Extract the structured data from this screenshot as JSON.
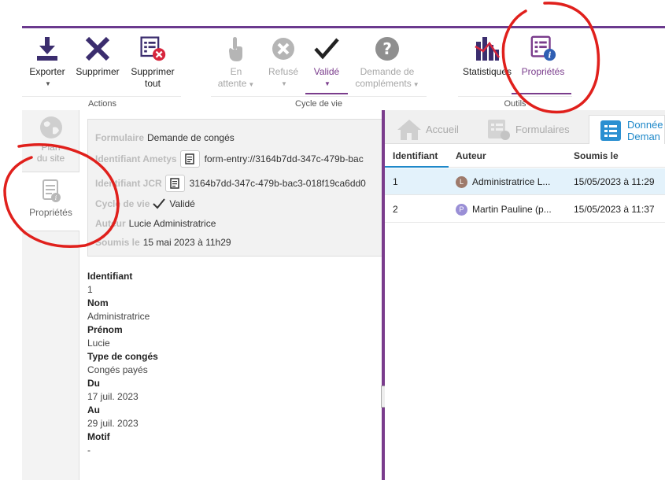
{
  "ribbon": {
    "buttons": {
      "exporter": "Exporter",
      "supprimer": "Supprimer",
      "supprimer_tout_l1": "Supprimer",
      "supprimer_tout_l2": "tout",
      "en_attente_l1": "En",
      "en_attente_l2": "attente",
      "refuse": "Refusé",
      "valide": "Validé",
      "demande_l1": "Demande de",
      "demande_l2": "compléments",
      "statistiques": "Statistiques",
      "proprietes": "Propriétés"
    },
    "groups": {
      "actions": "Actions",
      "cycle": "Cycle de vie",
      "outils": "Outils"
    }
  },
  "left_tabs": {
    "plan_l1": "Plan",
    "plan_l2": "du site",
    "proprietes": "Propriétés"
  },
  "properties": {
    "formulaire_label": "Formulaire",
    "formulaire_value": "Demande de congés",
    "identifiant_ametys_label": "Identifiant Ametys",
    "identifiant_ametys_value": "form-entry://3164b7dd-347c-479b-bac",
    "identifiant_jcr_label": "Identifiant JCR",
    "identifiant_jcr_value": "3164b7dd-347c-479b-bac3-018f19ca6dd0",
    "cycle_label": "Cycle de vie",
    "cycle_value": "Validé",
    "auteur_label": "Auteur",
    "auteur_value": "Lucie Administratrice",
    "soumis_label": "Soumis le",
    "soumis_value": "15 mai 2023 à 11h29"
  },
  "fields": [
    {
      "label": "Identifiant",
      "value": "1"
    },
    {
      "label": "Nom",
      "value": "Administratrice"
    },
    {
      "label": "Prénom",
      "value": "Lucie"
    },
    {
      "label": "Type de congés",
      "value": "Congés payés"
    },
    {
      "label": "Du",
      "value": "17 juil. 2023"
    },
    {
      "label": "Au",
      "value": "29 juil. 2023"
    },
    {
      "label": "Motif",
      "value": "-"
    }
  ],
  "right_tabs": {
    "accueil": "Accueil",
    "formulaires": "Formulaires",
    "donnees_l1": "Donnée",
    "donnees_l2": "Deman"
  },
  "table": {
    "headers": {
      "identifiant": "Identifiant",
      "auteur": "Auteur",
      "soumis": "Soumis le"
    },
    "rows": [
      {
        "id": "1",
        "initial": "L",
        "auteur": "Administratrice L...",
        "soumis": "15/05/2023 à 11:29",
        "avatar_color": "#9e7a6b"
      },
      {
        "id": "2",
        "initial": "P",
        "auteur": "Martin Pauline (p...",
        "soumis": "15/05/2023 à 11:37",
        "avatar_color": "#9a8fd6"
      }
    ]
  },
  "colors": {
    "accent": "#7a3c8c",
    "blue": "#1e88c9",
    "annotation": "#e0201c"
  }
}
